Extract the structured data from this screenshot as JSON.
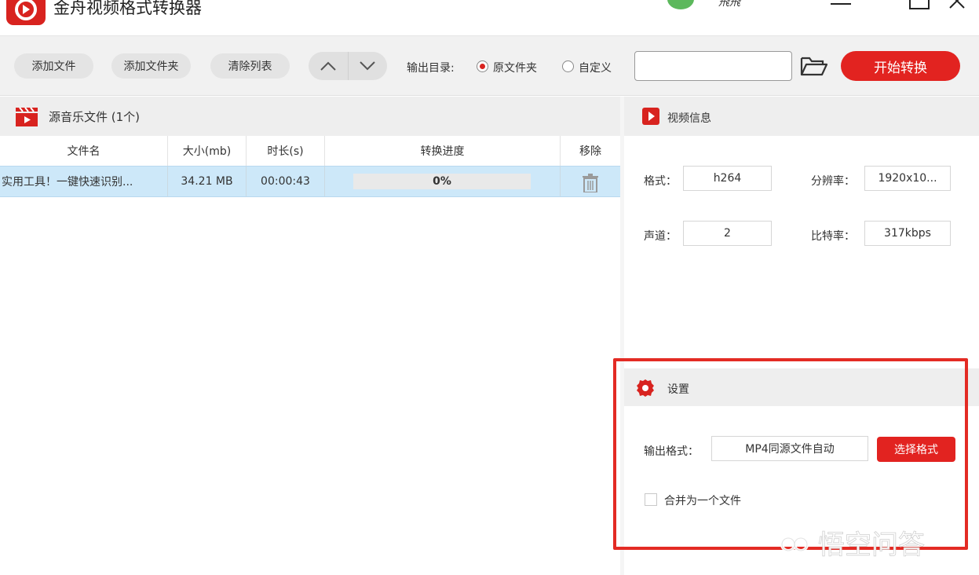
{
  "app": {
    "title": "金舟视频格式转换器",
    "user_name": "飛飛"
  },
  "toolbar": {
    "add_file": "添加文件",
    "add_folder": "添加文件夹",
    "clear_list": "清除列表",
    "output_dir_label": "输出目录:",
    "radio_original": "原文件夹",
    "radio_custom": "自定义",
    "selected_output": "原文件夹",
    "path_value": "",
    "start_button": "开始转换"
  },
  "file_panel": {
    "title": "源音乐文件 (1个)",
    "columns": [
      "文件名",
      "大小(mb)",
      "时长(s)",
      "转换进度",
      "移除"
    ],
    "rows": [
      {
        "name": "实用工具！一键快速识别...",
        "size": "34.21 MB",
        "duration": "00:00:43",
        "progress_text": "0%",
        "progress_value": 0
      }
    ]
  },
  "video_info": {
    "title": "视频信息",
    "format_label": "格式：",
    "format_value": "h264",
    "resolution_label": "分辨率：",
    "resolution_value": "1920x10...",
    "channels_label": "声道：",
    "channels_value": "2",
    "bitrate_label": "比特率：",
    "bitrate_value": "317kbps"
  },
  "settings": {
    "title": "设置",
    "output_format_label": "输出格式：",
    "output_format_value": "MP4同源文件自动",
    "choose_format_button": "选择格式",
    "merge_label": "合并为一个文件",
    "merge_checked": false
  },
  "watermark": {
    "text": "悟空问答"
  },
  "colors": {
    "accent": "#e22320",
    "row_selected": "#cde8f9",
    "header_bg": "#eeeeee",
    "highlight_frame": "#e32b24"
  }
}
